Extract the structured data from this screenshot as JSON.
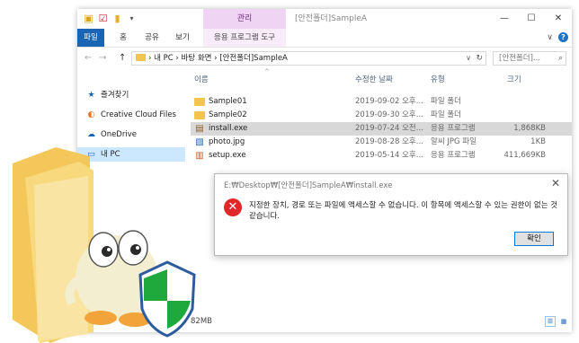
{
  "titlebar": {
    "ctx_tab": "관리",
    "window_title": "[안전폴더]SampleA",
    "minimize": "—",
    "maximize": "☐",
    "close": "✕"
  },
  "ribbon": {
    "tabs": [
      "파일",
      "홈",
      "공유",
      "보기",
      "응용 프로그램 도구"
    ],
    "chevron": "∨"
  },
  "address": {
    "back": "←",
    "forward": "→",
    "up": "↑",
    "path": "› 내 PC › 바탕 화면 › [안전폴더]SampleA",
    "search_placeholder": "[안전폴더]... ",
    "dropdown": "∨",
    "refresh": "↻",
    "search_icon": "⌕"
  },
  "nav": {
    "items": [
      {
        "label": "즐겨찾기",
        "icon": "star-icon",
        "glyph": "★",
        "color": "#1a64b4"
      },
      {
        "label": "Creative Cloud Files",
        "icon": "creative-cloud-icon",
        "glyph": "◐",
        "color": "#e8711a"
      },
      {
        "label": "OneDrive",
        "icon": "onedrive-icon",
        "glyph": "☁",
        "color": "#1a64b4"
      },
      {
        "label": "내 PC",
        "icon": "pc-icon",
        "glyph": "▭",
        "color": "#1a64b4"
      }
    ]
  },
  "list": {
    "headers": {
      "name": "이름",
      "date": "수정한 날짜",
      "type": "유형",
      "size": "크기"
    },
    "rows": [
      {
        "name": "Sample01",
        "date": "2019-09-02 오후...",
        "type": "파일 폴더",
        "size": "",
        "icon": "folder-icon"
      },
      {
        "name": "Sample02",
        "date": "2019-09-30 오후...",
        "type": "파일 폴더",
        "size": "",
        "icon": "folder-icon"
      },
      {
        "name": "install.exe",
        "date": "2019-07-24 오전...",
        "type": "응용 프로그램",
        "size": "1,868KB",
        "icon": "installer-icon",
        "selected": true
      },
      {
        "name": "photo.jpg",
        "date": "2019-08-28 오후...",
        "type": "알씨 JPG 파일",
        "size": "1KB",
        "icon": "image-file-icon"
      },
      {
        "name": "setup.exe",
        "date": "2019-05-14 오후...",
        "type": "응용 프로그램",
        "size": "411,669KB",
        "icon": "setup-icon"
      }
    ]
  },
  "status": {
    "text": "82MB"
  },
  "dialog": {
    "title": "E:₩Desktop₩[안전폴더]SampleA₩install.exe",
    "close": "✕",
    "icon_glyph": "✕",
    "message": "지정한 장치, 경로 또는 파일에 액세스할 수 없습니다. 이 항목에 액세스할 수 있는 권한이 없는 것 같습니다.",
    "ok_label": "확인"
  },
  "colors": {
    "accent": "#1a64b4",
    "error": "#e12828",
    "ctx_tab": "#f0d4f3",
    "shield_green": "#1fa83c"
  }
}
